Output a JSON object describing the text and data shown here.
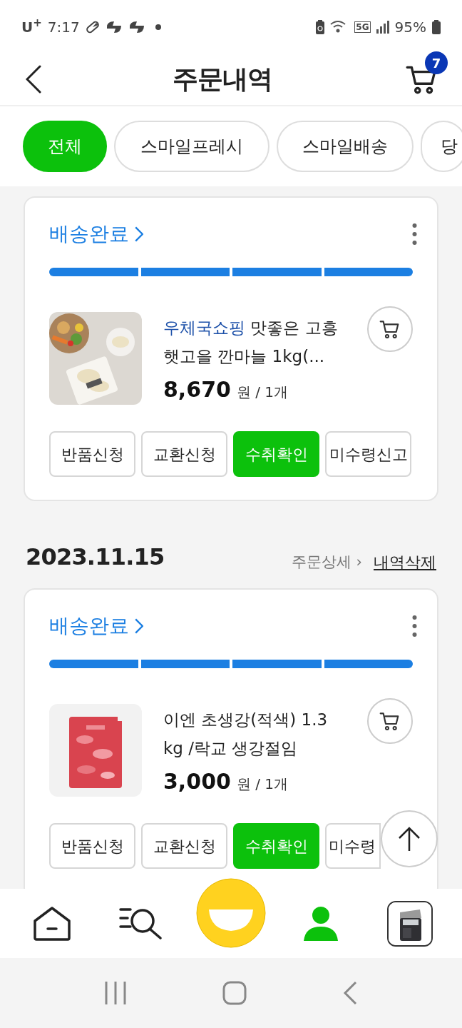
{
  "status_bar": {
    "carrier": "U$^{+}$",
    "time": "7:17",
    "network": "5G",
    "battery": "95%"
  },
  "header": {
    "title": "주문내역",
    "cart_count": "7"
  },
  "filters": [
    {
      "label": "전체",
      "selected": true
    },
    {
      "label": "스마일프레시",
      "selected": false
    },
    {
      "label": "스마일배송",
      "selected": false
    },
    {
      "label": "당",
      "selected": false
    }
  ],
  "orders": [
    {
      "status": "배송완료",
      "progress": [
        {
          "done": true
        },
        {
          "done": true
        },
        {
          "done": true
        },
        {
          "done": true
        }
      ],
      "item": {
        "kind": "garlic",
        "seller": "우체국쇼핑",
        "name": "맛좋은 고흥 햇고을 깐마늘 1kg(...",
        "price": "8,670",
        "unit": "원 / 1개"
      },
      "actions": [
        {
          "label": "반품신청",
          "highlighted": false
        },
        {
          "label": "교환신청",
          "highlighted": false
        },
        {
          "label": "수취확인",
          "highlighted": true
        },
        {
          "label": "미수령신고",
          "highlighted": false
        }
      ]
    },
    {
      "date": "2023.11.15",
      "detail_link": "주문상세 ›",
      "delete_link": "내역삭제",
      "status": "배송완료",
      "progress": [
        {
          "done": true
        },
        {
          "done": true
        },
        {
          "done": true
        },
        {
          "done": true
        }
      ],
      "item": {
        "kind": "ginger",
        "name": "이엔 초생강(적색) 1.3 kg /락교 생강절임",
        "price": "3,000",
        "unit": "원 / 1개"
      },
      "actions": [
        {
          "label": "반품신청",
          "highlighted": false
        },
        {
          "label": "교환신청",
          "highlighted": false
        },
        {
          "label": "수취확인",
          "highlighted": true
        },
        {
          "label": "미수령",
          "highlighted": false
        }
      ]
    }
  ],
  "bottom_nav": [
    {
      "kind": "home",
      "selected": false
    },
    {
      "kind": "search",
      "selected": false
    },
    {
      "kind": "smile",
      "selected": false
    },
    {
      "kind": "profile",
      "selected": true
    },
    {
      "kind": "recent",
      "selected": false
    }
  ]
}
